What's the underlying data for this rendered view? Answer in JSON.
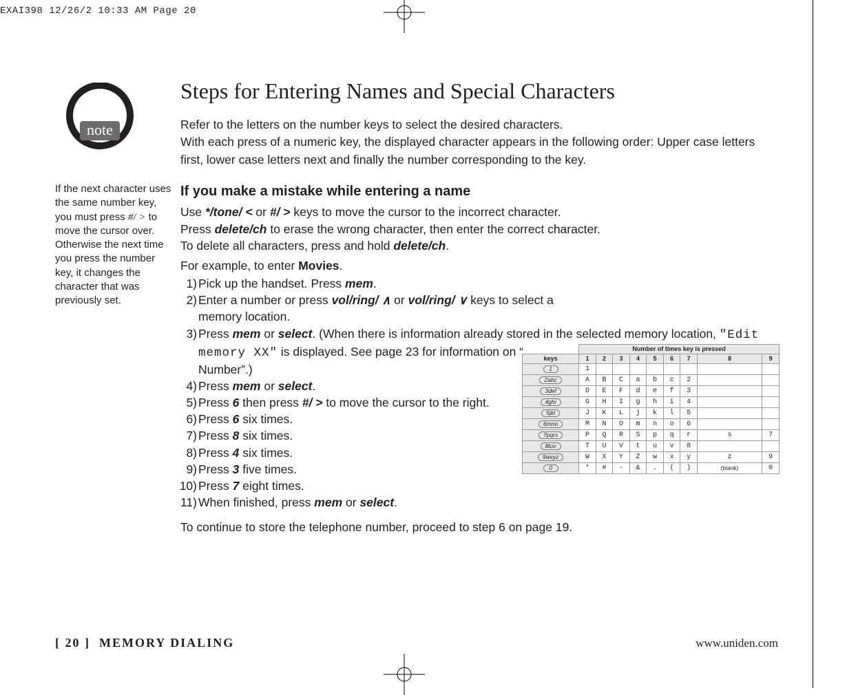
{
  "imposition_header": "EXAI398  12/26/2 10:33 AM  Page 20",
  "sidebar": {
    "note_label": "note",
    "note_text_1": "If the next character uses the same number key, you must press ",
    "note_key": "#/ >",
    "note_text_2": " to move the cursor over. Otherwise the next time you press the number key, it changes the character that was previously set."
  },
  "main": {
    "title": "Steps for Entering Names and Special Characters",
    "intro": "Refer to the letters on the number keys to select the desired characters.\nWith each press of a numeric key, the displayed character appears in the following order: Upper case letters first, lower case letters next and finally the number corresponding to the key.",
    "subhead": "If you make a mistake while entering a name",
    "mistake_para_1a": "Use ",
    "mistake_key1": "*/tone/ <",
    "mistake_para_1b": " or ",
    "mistake_key2": "#/ >",
    "mistake_para_1c": " keys to move the cursor to the incorrect character.",
    "mistake_para_2a": "Press ",
    "delete_ch": "delete/ch",
    "mistake_para_2b": " to erase the wrong character, then enter the correct character.",
    "mistake_para_3a": "To delete all characters, press and hold ",
    "mistake_para_3b": ".",
    "example_lead_a": "For example, to enter ",
    "example_word": "Movies",
    "example_lead_b": ".",
    "steps": [
      "Pick up the handset. Press <bi>mem</bi>.",
      "Enter a number or press <bi>vol/ring/ ∧</bi> or <bi>vol/ring/ ∨</bi> keys to select a memory location.",
      "Press <bi>mem</bi> or <bi>select</bi>. (When there is information already stored in the selected memory location, <lcd>\"Edit memory XX\"</lcd> is displayed. See page 23 for information on “Editing a Stored Name and/or Phone Number”.)",
      "Press <bi>mem</bi> or <bi>select</bi>.",
      "Press <bi>6</bi> then press <bi>#/ ></bi> to move the cursor to the right.",
      "Press <bi>6</bi> six times.",
      "Press <bi>8</bi> six times.",
      "Press <bi>4</bi> six times.",
      "Press <bi>3</bi> five times.",
      "Press <bi>7</bi> eight times.",
      "When finished, press <bi>mem</bi> or <bi>select</bi>."
    ],
    "after_steps": "To continue to store the telephone number, proceed to step 6 on page 19."
  },
  "char_table": {
    "header_span": "Number of times key is pressed",
    "col_keys": "keys",
    "cols": [
      "1",
      "2",
      "3",
      "4",
      "5",
      "6",
      "7",
      "8",
      "9"
    ],
    "rows": [
      {
        "key": "1",
        "cells": [
          "1",
          "",
          "",
          "",
          "",
          "",
          "",
          "",
          ""
        ]
      },
      {
        "key": "2abc",
        "cells": [
          "A",
          "B",
          "C",
          "a",
          "b",
          "c",
          "2",
          "",
          ""
        ]
      },
      {
        "key": "3def",
        "cells": [
          "D",
          "E",
          "F",
          "d",
          "e",
          "f",
          "3",
          "",
          ""
        ]
      },
      {
        "key": "4ghi",
        "cells": [
          "G",
          "H",
          "I",
          "g",
          "h",
          "i",
          "4",
          "",
          ""
        ]
      },
      {
        "key": "5jkl",
        "cells": [
          "J",
          "K",
          "L",
          "j",
          "k",
          "l",
          "5",
          "",
          ""
        ]
      },
      {
        "key": "6mno",
        "cells": [
          "M",
          "N",
          "O",
          "m",
          "n",
          "o",
          "6",
          "",
          ""
        ]
      },
      {
        "key": "7pqrs",
        "cells": [
          "P",
          "Q",
          "R",
          "S",
          "p",
          "q",
          "r",
          "s",
          "7"
        ]
      },
      {
        "key": "8tuv",
        "cells": [
          "T",
          "U",
          "V",
          "t",
          "u",
          "v",
          "8",
          "",
          ""
        ]
      },
      {
        "key": "9wxyz",
        "cells": [
          "W",
          "X",
          "Y",
          "Z",
          "w",
          "x",
          "y",
          "z",
          "9"
        ]
      },
      {
        "key": "0",
        "cells": [
          "*",
          "#",
          "-",
          "&",
          ".",
          "(",
          ")",
          "(blank)",
          "0"
        ]
      }
    ]
  },
  "footer": {
    "page_number": "[ 20 ]",
    "section": "MEMORY DIALING",
    "url": "www.uniden.com"
  }
}
